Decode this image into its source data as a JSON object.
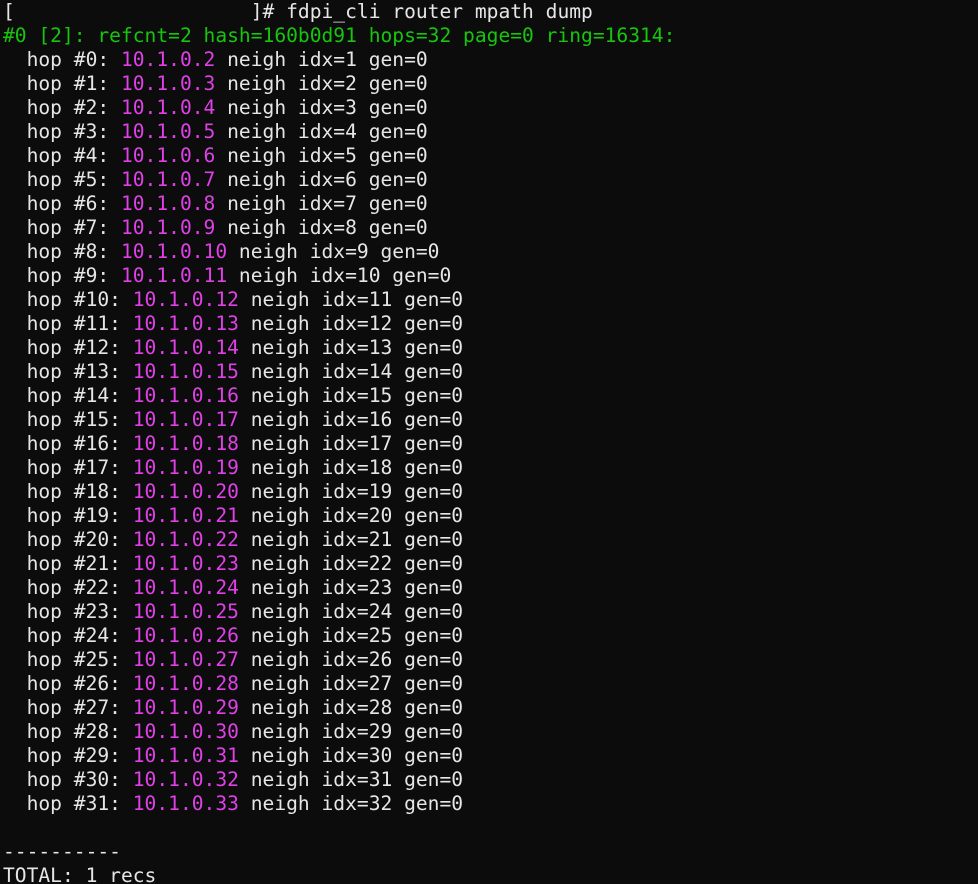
{
  "prompt": {
    "open_bracket": "[",
    "host_redacted": "                    ",
    "close_suffix": "]# ",
    "command": "fdpi_cli router mpath dump"
  },
  "header": {
    "text": "#0 [2]: refcnt=2 hash=160b0d91 hops=32 page=0 ring=16314:"
  },
  "colors": {
    "background": "#0c0c0c",
    "text": "#e6e6e6",
    "header": "#16c60c",
    "ip": "#e040e8"
  },
  "hops": [
    {
      "label": "hop #0: ",
      "ip": "10.1.0.2",
      "rest": " neigh idx=1 gen=0"
    },
    {
      "label": "hop #1: ",
      "ip": "10.1.0.3",
      "rest": " neigh idx=2 gen=0"
    },
    {
      "label": "hop #2: ",
      "ip": "10.1.0.4",
      "rest": " neigh idx=3 gen=0"
    },
    {
      "label": "hop #3: ",
      "ip": "10.1.0.5",
      "rest": " neigh idx=4 gen=0"
    },
    {
      "label": "hop #4: ",
      "ip": "10.1.0.6",
      "rest": " neigh idx=5 gen=0"
    },
    {
      "label": "hop #5: ",
      "ip": "10.1.0.7",
      "rest": " neigh idx=6 gen=0"
    },
    {
      "label": "hop #6: ",
      "ip": "10.1.0.8",
      "rest": " neigh idx=7 gen=0"
    },
    {
      "label": "hop #7: ",
      "ip": "10.1.0.9",
      "rest": " neigh idx=8 gen=0"
    },
    {
      "label": "hop #8: ",
      "ip": "10.1.0.10",
      "rest": " neigh idx=9 gen=0"
    },
    {
      "label": "hop #9: ",
      "ip": "10.1.0.11",
      "rest": " neigh idx=10 gen=0"
    },
    {
      "label": "hop #10: ",
      "ip": "10.1.0.12",
      "rest": " neigh idx=11 gen=0"
    },
    {
      "label": "hop #11: ",
      "ip": "10.1.0.13",
      "rest": " neigh idx=12 gen=0"
    },
    {
      "label": "hop #12: ",
      "ip": "10.1.0.14",
      "rest": " neigh idx=13 gen=0"
    },
    {
      "label": "hop #13: ",
      "ip": "10.1.0.15",
      "rest": " neigh idx=14 gen=0"
    },
    {
      "label": "hop #14: ",
      "ip": "10.1.0.16",
      "rest": " neigh idx=15 gen=0"
    },
    {
      "label": "hop #15: ",
      "ip": "10.1.0.17",
      "rest": " neigh idx=16 gen=0"
    },
    {
      "label": "hop #16: ",
      "ip": "10.1.0.18",
      "rest": " neigh idx=17 gen=0"
    },
    {
      "label": "hop #17: ",
      "ip": "10.1.0.19",
      "rest": " neigh idx=18 gen=0"
    },
    {
      "label": "hop #18: ",
      "ip": "10.1.0.20",
      "rest": " neigh idx=19 gen=0"
    },
    {
      "label": "hop #19: ",
      "ip": "10.1.0.21",
      "rest": " neigh idx=20 gen=0"
    },
    {
      "label": "hop #20: ",
      "ip": "10.1.0.22",
      "rest": " neigh idx=21 gen=0"
    },
    {
      "label": "hop #21: ",
      "ip": "10.1.0.23",
      "rest": " neigh idx=22 gen=0"
    },
    {
      "label": "hop #22: ",
      "ip": "10.1.0.24",
      "rest": " neigh idx=23 gen=0"
    },
    {
      "label": "hop #23: ",
      "ip": "10.1.0.25",
      "rest": " neigh idx=24 gen=0"
    },
    {
      "label": "hop #24: ",
      "ip": "10.1.0.26",
      "rest": " neigh idx=25 gen=0"
    },
    {
      "label": "hop #25: ",
      "ip": "10.1.0.27",
      "rest": " neigh idx=26 gen=0"
    },
    {
      "label": "hop #26: ",
      "ip": "10.1.0.28",
      "rest": " neigh idx=27 gen=0"
    },
    {
      "label": "hop #27: ",
      "ip": "10.1.0.29",
      "rest": " neigh idx=28 gen=0"
    },
    {
      "label": "hop #28: ",
      "ip": "10.1.0.30",
      "rest": " neigh idx=29 gen=0"
    },
    {
      "label": "hop #29: ",
      "ip": "10.1.0.31",
      "rest": " neigh idx=30 gen=0"
    },
    {
      "label": "hop #30: ",
      "ip": "10.1.0.32",
      "rest": " neigh idx=31 gen=0"
    },
    {
      "label": "hop #31: ",
      "ip": "10.1.0.33",
      "rest": " neigh idx=32 gen=0"
    }
  ],
  "separator": "----------",
  "total": "TOTAL: 1 recs"
}
